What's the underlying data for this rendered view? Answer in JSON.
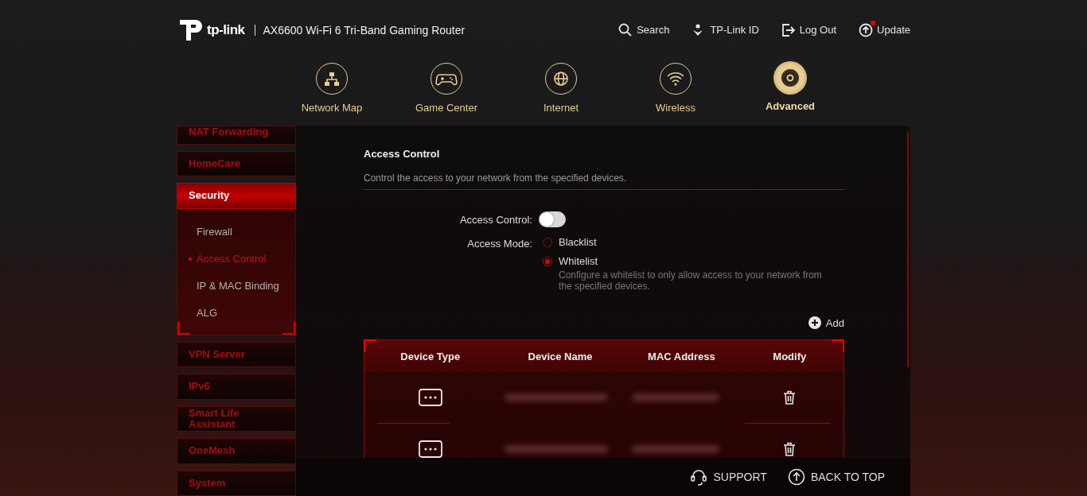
{
  "header": {
    "logo_text": "tp-link",
    "product": "AX6600 Wi-Fi 6 Tri-Band Gaming Router",
    "actions": [
      {
        "kind": "search",
        "label": "Search",
        "badge": false
      },
      {
        "kind": "id",
        "label": "TP-Link ID",
        "badge": false
      },
      {
        "kind": "logout",
        "label": "Log Out",
        "badge": false
      },
      {
        "kind": "update",
        "label": "Update",
        "badge": true
      }
    ]
  },
  "nav": [
    {
      "kind": "network",
      "label": "Network Map",
      "selected": false
    },
    {
      "kind": "game",
      "label": "Game Center",
      "selected": false
    },
    {
      "kind": "internet",
      "label": "Internet",
      "selected": false
    },
    {
      "kind": "wireless",
      "label": "Wireless",
      "selected": false
    },
    {
      "kind": "advanced",
      "label": "Advanced",
      "selected": true
    }
  ],
  "sidebar": {
    "items": [
      {
        "label": "NAT Forwarding",
        "selected": false
      },
      {
        "label": "HomeCare",
        "selected": false
      },
      {
        "label": "Security",
        "selected": true,
        "expanded": true,
        "children": [
          {
            "label": "Firewall",
            "selected": false
          },
          {
            "label": "Access Control",
            "selected": true
          },
          {
            "label": "IP & MAC Binding",
            "selected": false
          },
          {
            "label": "ALG",
            "selected": false
          }
        ]
      },
      {
        "label": "VPN Server",
        "selected": false
      },
      {
        "label": "IPv6",
        "selected": false
      },
      {
        "label": "Smart Life Assistant",
        "selected": false
      },
      {
        "label": "OneMesh",
        "selected": false
      },
      {
        "label": "System",
        "selected": false
      }
    ]
  },
  "section": {
    "title": "Access Control",
    "description": "Control the access to your network from the specified devices.",
    "toggle": {
      "label": "Access Control:",
      "on": false
    },
    "mode": {
      "label": "Access Mode:",
      "options": [
        {
          "label": "Blacklist",
          "selected": false
        },
        {
          "label": "Whitelist",
          "selected": true
        }
      ],
      "hint": "Configure a whitelist to only allow access to your network from the specified devices."
    },
    "add_label": "Add",
    "table": {
      "columns": [
        "Device Type",
        "Device Name",
        "MAC Address",
        "Modify"
      ],
      "rows": [
        {
          "kind": "other"
        },
        {
          "kind": "other"
        }
      ]
    }
  },
  "footer": {
    "support": "SUPPORT",
    "back_to_top": "BACK TO TOP"
  }
}
